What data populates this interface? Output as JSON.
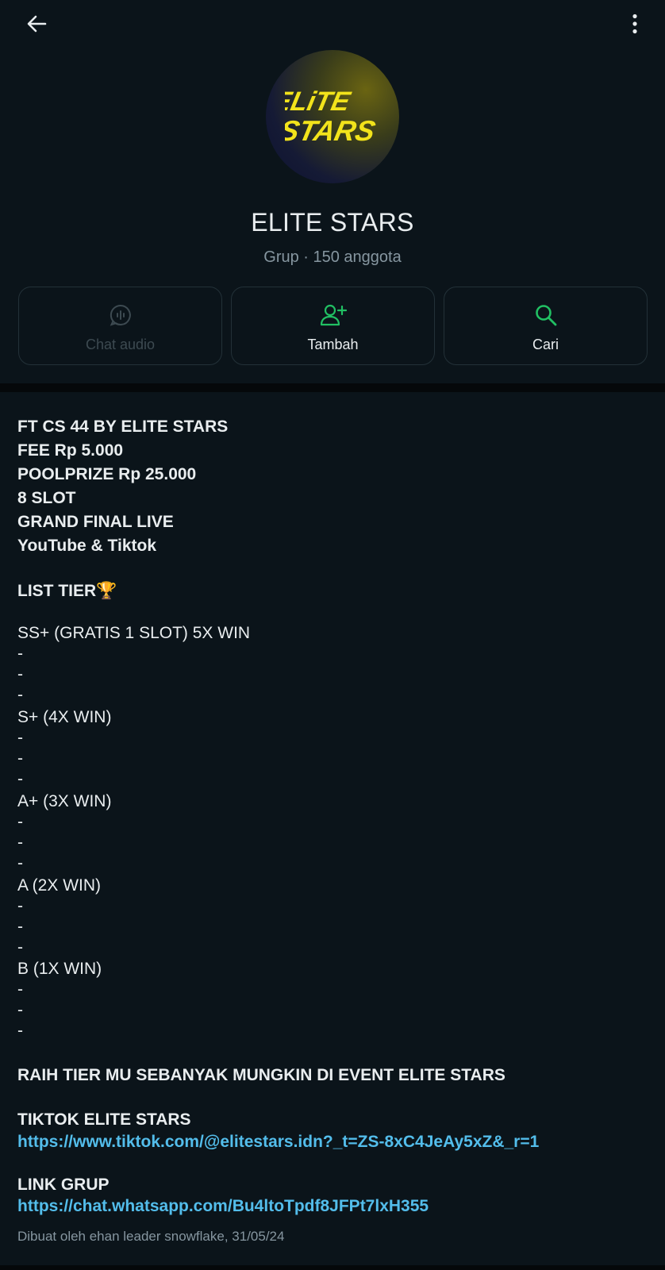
{
  "header": {
    "group_name": "ELITE STARS",
    "group_info": "Grup · 150 anggota",
    "logo_line1": "ELiTE",
    "logo_line2": "STARS"
  },
  "actions": {
    "chat_audio": "Chat audio",
    "add": "Tambah",
    "search": "Cari"
  },
  "description": {
    "lines": [
      "FT CS 44 BY ELITE STARS",
      "FEE Rp 5.000",
      "POOLPRIZE Rp 25.000",
      "8 SLOT",
      "GRAND FINAL LIVE",
      "YouTube & Tiktok",
      "LIST TIER🏆",
      "SS+ (GRATIS 1 SLOT) 5X WIN",
      "-",
      "-",
      "-",
      "S+ (4X WIN)",
      "-",
      "-",
      "-",
      "A+ (3X WIN)",
      "-",
      "-",
      "-",
      "A (2X WIN)",
      "-",
      "-",
      "-",
      "B (1X WIN)",
      "-",
      "-",
      "-",
      "RAIH TIER MU SEBANYAK MUNGKIN DI EVENT ELITE STARS",
      "TIKTOK ELITE STARS",
      "https://www.tiktok.com/@elitestars.idn?_t=ZS-8xC4JeAy5xZ&_r=1",
      "LINK GRUP",
      "https://chat.whatsapp.com/Bu4ltoTpdf8JFPt7lxH355"
    ],
    "created_by": "Dibuat oleh ehan leader snowflake, 31/05/24"
  },
  "colors": {
    "accent_green": "#21c063",
    "link_blue": "#53bdeb",
    "logo_yellow": "#f2e31b"
  }
}
